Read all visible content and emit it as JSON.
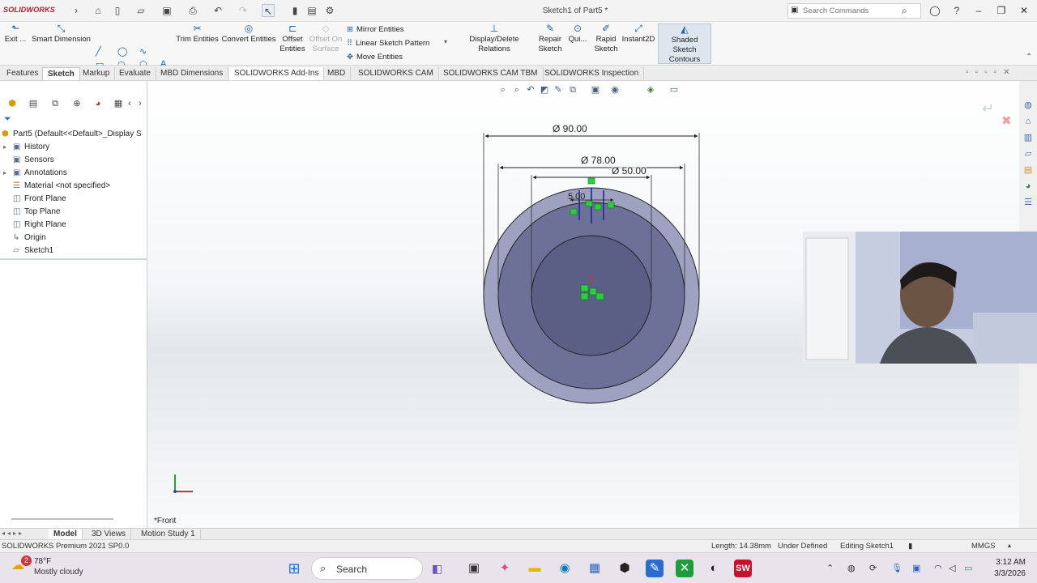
{
  "app": {
    "logo": "SOLIDWORKS",
    "doc_title": "Sketch1 of Part5 *",
    "search_placeholder": "Search Commands"
  },
  "commands": {
    "exit_label": "Exit ...",
    "smart_dimension": "Smart Dimension",
    "trim_entities": "Trim Entities",
    "convert_entities": "Convert Entities",
    "offset_entities_1": "Offset",
    "offset_entities_2": "Entities",
    "offset_surface_1": "Offset On",
    "offset_surface_2": "Surface",
    "mirror_entities": "Mirror Entities",
    "linear_pattern": "Linear Sketch Pattern",
    "move_entities": "Move Entities",
    "display_delete": "Display/Delete Relations",
    "repair_1": "Repair",
    "repair_2": "Sketch",
    "quick": "Qui...",
    "rapid_1": "Rapid",
    "rapid_2": "Sketch",
    "instant2d": "Instant2D",
    "shaded_1": "Shaded Sketch",
    "shaded_2": "Contours"
  },
  "tabs": [
    "Features",
    "Sketch",
    "Markup",
    "Evaluate",
    "MBD Dimensions",
    "SOLIDWORKS Add-Ins",
    "MBD",
    "SOLIDWORKS CAM",
    "SOLIDWORKS CAM TBM",
    "SOLIDWORKS Inspection"
  ],
  "tree": {
    "root": "Part5  (Default<<Default>_Display S",
    "items": [
      "History",
      "Sensors",
      "Annotations",
      "Material <not specified>",
      "Front Plane",
      "Top Plane",
      "Right Plane",
      "Origin",
      "Sketch1"
    ]
  },
  "sketch": {
    "dim_outer": "Ø 90.00",
    "dim_middle": "Ø 78.00",
    "dim_inner": "Ø 50.00",
    "dim_small": "5.00",
    "view_label": "*Front"
  },
  "bottom_tabs": [
    "Model",
    "3D Views",
    "Motion Study 1"
  ],
  "status": {
    "product": "SOLIDWORKS Premium 2021 SP0.0",
    "length": "Length: 14.38mm",
    "state": "Under Defined",
    "editing": "Editing Sketch1",
    "units": "MMGS"
  },
  "taskbar": {
    "weather_temp": "78°F",
    "weather_desc": "Mostly cloudy",
    "weather_badge": "2",
    "search_label": "Search",
    "time": "3:12 AM",
    "date": "3/3/2026"
  },
  "colors": {
    "accent": "#1e5fa8",
    "sketch_fill": "#5b5e85",
    "sketch_green": "#2ecc40",
    "logo_red": "#c8102e"
  }
}
